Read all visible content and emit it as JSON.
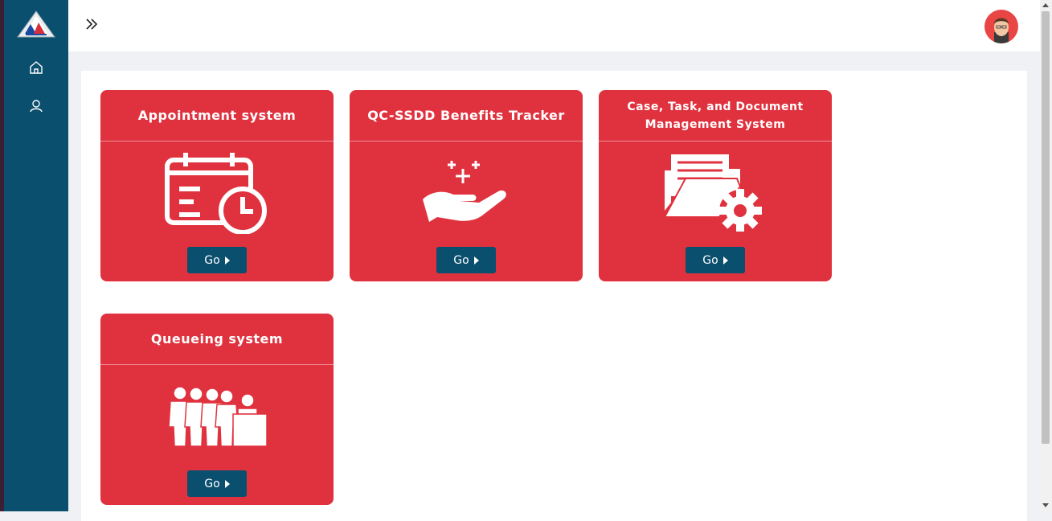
{
  "sidebar": {
    "logo": "agency-logo",
    "items": [
      {
        "icon": "home-icon"
      },
      {
        "icon": "user-icon"
      }
    ]
  },
  "topbar": {
    "toggle_icon": "double-chevron-right-icon",
    "avatar_icon": "user-avatar"
  },
  "cards": [
    {
      "title": "Appointment system",
      "icon": "calendar-clock-icon",
      "button_label": "Go"
    },
    {
      "title": "QC-SSDD Benefits Tracker",
      "icon": "hand-sparkle-icon",
      "button_label": "Go"
    },
    {
      "title": "Case, Task, and Document Management System",
      "icon": "folder-gear-icon",
      "button_label": "Go"
    },
    {
      "title": "Queueing system",
      "icon": "queue-people-icon",
      "button_label": "Go"
    }
  ],
  "colors": {
    "sidebar": "#0a4f6e",
    "card": "#e0323e",
    "button": "#0a4f6e",
    "background": "#eff1f5"
  }
}
